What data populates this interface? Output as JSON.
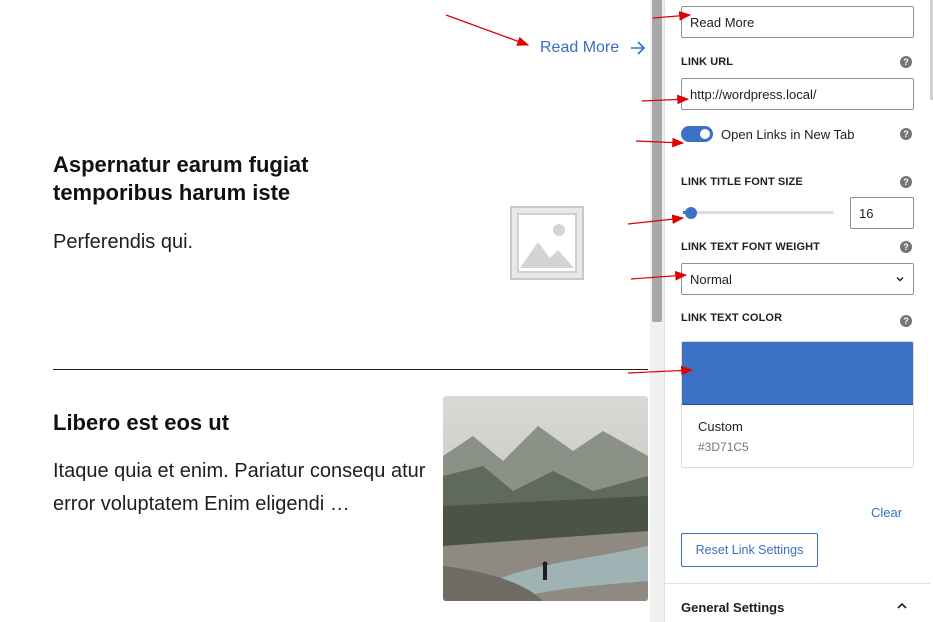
{
  "editor": {
    "read_more_label": "Read More",
    "post1": {
      "title": "Aspernatur earum fugiat temporibus harum iste",
      "excerpt": "Perferendis qui."
    },
    "post2": {
      "title": "Libero est eos ut",
      "excerpt": "Itaque quia et enim. Pariatur consequ atur error voluptatem Enim eligendi …"
    }
  },
  "sidebar": {
    "link_text_value": "Read More",
    "link_url_label": "LINK URL",
    "link_url_value": "http://wordpress.local/",
    "open_new_tab_label": "Open Links in New Tab",
    "open_new_tab_on": true,
    "title_font_size_label": "LINK TITLE FONT SIZE",
    "title_font_size_value": "16",
    "font_weight_label": "LINK TEXT FONT WEIGHT",
    "font_weight_value": "Normal",
    "text_color_label": "LINK TEXT COLOR",
    "color_name": "Custom",
    "color_hex": "#3D71C5",
    "clear_label": "Clear",
    "reset_label": "Reset Link Settings",
    "general_settings_label": "General Settings",
    "help_glyph": "?"
  },
  "colors": {
    "accent": "#3d71c5",
    "link": "#3b6fbf",
    "annotation_arrow": "#e00000"
  },
  "icons": {
    "read_more_arrow": "arrow-right-icon",
    "placeholder": "image-placeholder-icon",
    "select_caret": "chevron-down-icon",
    "panel_toggle": "chevron-up-icon"
  }
}
